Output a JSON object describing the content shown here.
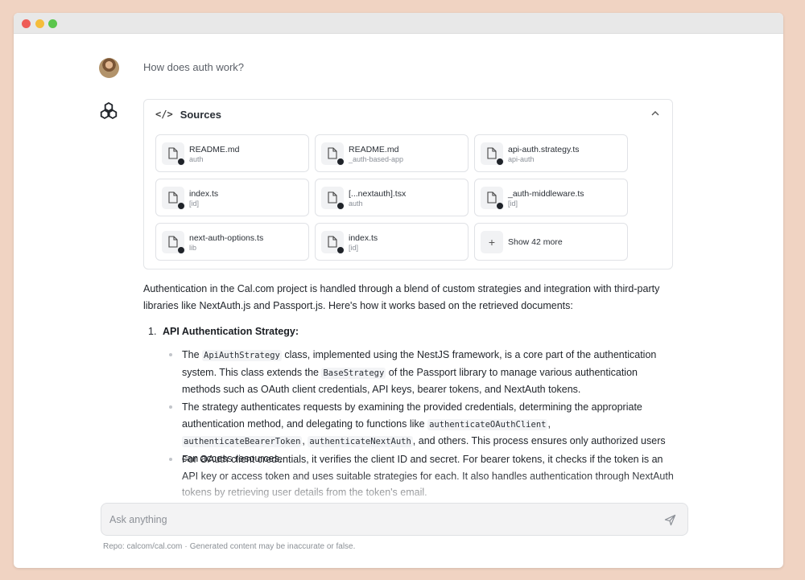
{
  "chat": {
    "question": "How does auth work?"
  },
  "sources": {
    "title": "Sources",
    "cards": [
      {
        "name": "README.md",
        "sub": "auth"
      },
      {
        "name": "README.md",
        "sub": "_auth-based-app"
      },
      {
        "name": "api-auth.strategy.ts",
        "sub": "api-auth"
      },
      {
        "name": "index.ts",
        "sub": "[id]"
      },
      {
        "name": "[...nextauth].tsx",
        "sub": "auth"
      },
      {
        "name": "_auth-middleware.ts",
        "sub": "[id]"
      },
      {
        "name": "next-auth-options.ts",
        "sub": "lib"
      },
      {
        "name": "index.ts",
        "sub": "[id]"
      }
    ],
    "show_more": "Show 42 more"
  },
  "answer": {
    "intro": "Authentication in the Cal.com project is handled through a blend of custom strategies and integration with third-party libraries like NextAuth.js and Passport.js. Here's how it works based on the retrieved documents:",
    "item1_num": "1.",
    "item1_title": "API Authentication Strategy:",
    "b1": {
      "t1": "The ",
      "c1": "ApiAuthStrategy",
      "t2": " class, implemented using the NestJS framework, is a core part of the authentication system. This class extends the ",
      "c2": "BaseStrategy",
      "t3": " of the Passport library to manage various authentication methods such as OAuth client credentials, API keys, bearer tokens, and NextAuth tokens."
    },
    "b2": {
      "t1": "The strategy authenticates requests by examining the provided credentials, determining the appropriate authentication method, and delegating to functions like ",
      "c1": "authenticateOAuthClient",
      "t2": ", ",
      "c2": "authenticateBearerToken",
      "t3": ", ",
      "c3": "authenticateNextAuth",
      "t4": ", and others. This process ensures only authorized users can access resources."
    },
    "b3": "For OAuth client credentials, it verifies the client ID and secret. For bearer tokens, it checks if the token is an API key or access token and uses suitable strategies for each. It also handles authentication through NextAuth tokens by retrieving user details from the token's email."
  },
  "input": {
    "placeholder": "Ask anything"
  },
  "footer": {
    "repo": "Repo: calcom/cal.com",
    "separator": "·",
    "disclaimer": "Generated content may be inaccurate or false."
  }
}
